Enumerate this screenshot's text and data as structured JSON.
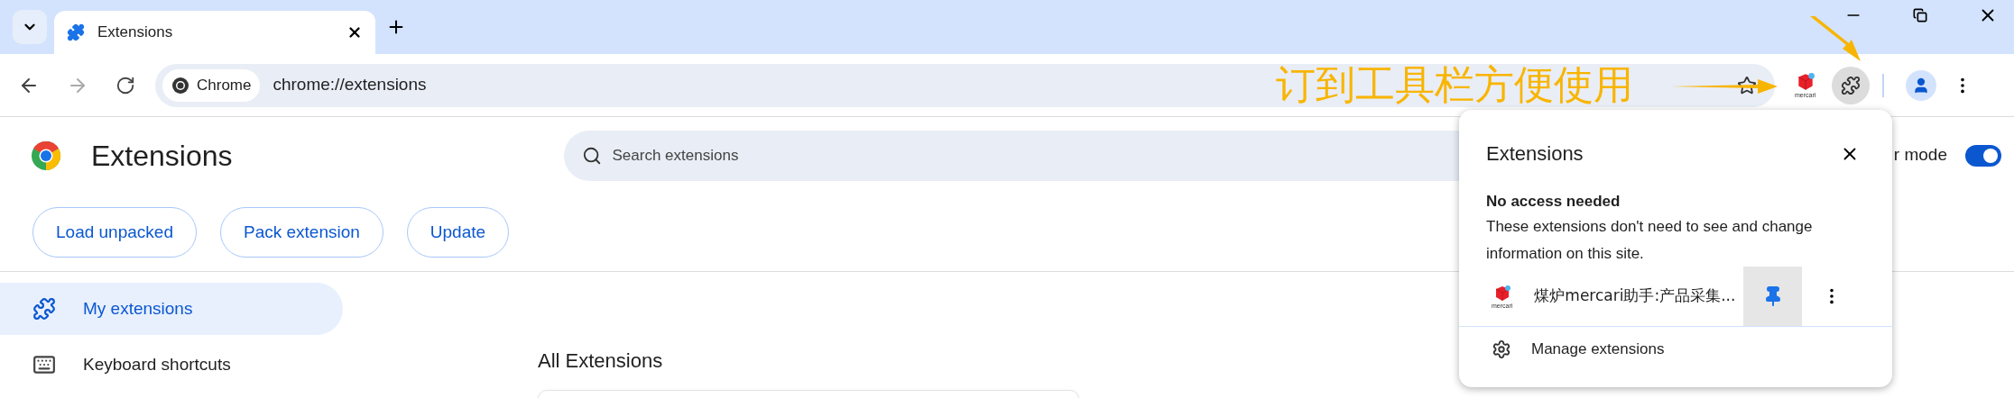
{
  "tab_strip": {
    "tabs": [
      {
        "title": "Extensions",
        "selected": true
      }
    ]
  },
  "toolbar": {
    "chip": "Chrome",
    "url": "chrome://extensions",
    "extension_icon_label": "mercari"
  },
  "annotation": {
    "text": "订到工具栏方便使用"
  },
  "page": {
    "title": "Extensions",
    "search_placeholder": "Search extensions",
    "developer_mode": {
      "label": "r mode",
      "on": true
    },
    "buttons": [
      "Load unpacked",
      "Pack extension",
      "Update"
    ],
    "sidebar": [
      {
        "label": "My extensions",
        "selected": true
      },
      {
        "label": "Keyboard shortcuts",
        "selected": false
      }
    ],
    "section_title": "All Extensions"
  },
  "popup": {
    "title": "Extensions",
    "section_title": "No access needed",
    "description": "These extensions don't need to see and change information on this site.",
    "extensions": [
      {
        "name": "煤炉mercari助手:产品采集...",
        "icon_label": "mercari",
        "pinned": true
      }
    ],
    "manage": "Manage extensions"
  }
}
